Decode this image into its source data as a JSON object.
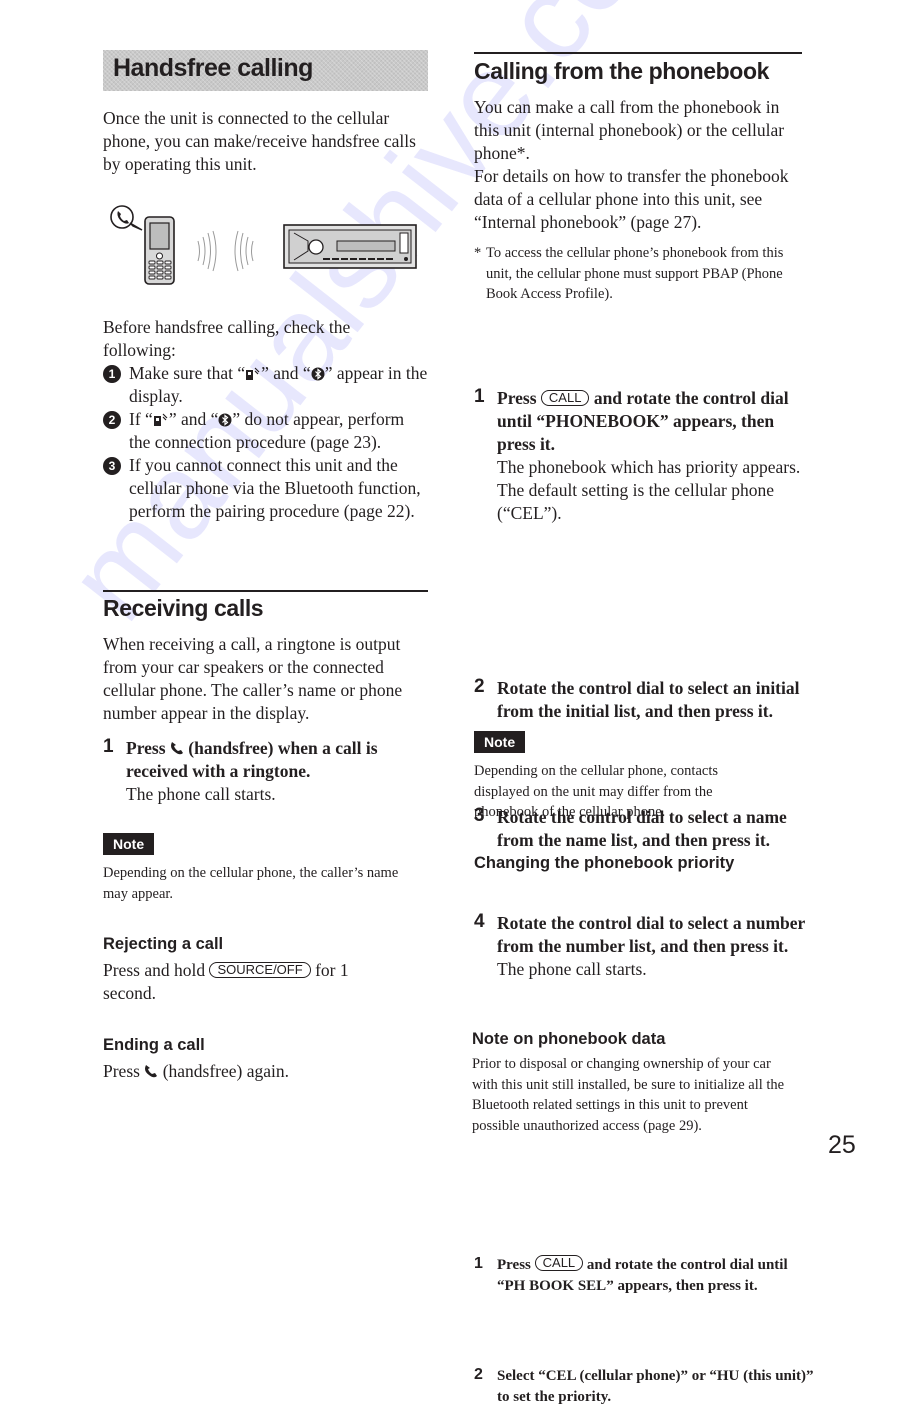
{
  "page_number": "25",
  "watermark": "manualshive.com",
  "left": {
    "title": "Handsfree calling",
    "intro": "Once the unit is connected to the cellular phone, you can make/receive handsfree calls by operating this unit.",
    "illustration": {
      "phone_icon": "mobile-phone-icon",
      "waves_icon": "signal-waves-icon",
      "unit_icon": "car-stereo-icon"
    },
    "checklist_intro": "Before handsfree calling, check the following:",
    "checklist": [
      {
        "num": "1",
        "parts": [
          "Make sure that “",
          "” and “",
          "” appear in the display."
        ]
      },
      {
        "num": "2",
        "parts": [
          "If “",
          "” and “",
          "” do not appear, perform the connection procedure (page 23)."
        ]
      },
      {
        "num": "3",
        "text": "If you cannot connect this unit and the cellular phone via the Bluetooth function, perform the pairing procedure (page 22)."
      }
    ],
    "receiving": {
      "heading": "Receiving calls",
      "body": "When receiving a call, a ringtone is output from your car speakers or the connected cellular phone. The caller’s name or phone number appear in the display.",
      "step": {
        "num": "1",
        "bold_pre": "Press",
        "bold_post": "(handsfree) when a call is received with a ringtone.",
        "result": "The phone call starts."
      },
      "note_label": "Note",
      "note_text": "Depending on the cellular phone, the caller’s name may appear."
    },
    "rejecting": {
      "heading": "Rejecting a call",
      "pre": "Press and hold",
      "key": "SOURCE/OFF",
      "post": "for 1 second."
    },
    "ending": {
      "heading": "Ending a call",
      "pre": "Press",
      "post": "(handsfree) again."
    }
  },
  "right": {
    "heading": "Calling from the phonebook",
    "intro1": "You can make a call from the phonebook in this unit (internal phonebook) or the cellular phone*.",
    "intro2": "For details on how to transfer the phonebook data of a cellular phone into this unit, see “Internal phonebook” (page 27).",
    "footnote": "To access the cellular phone’s phonebook from this unit, the cellular phone must support PBAP (Phone Book Access Profile).",
    "footnote_mark": "*",
    "steps": [
      {
        "num": "1",
        "pre": "Press",
        "key": "CALL",
        "post": "and rotate the control dial until “PHONEBOOK” appears, then press it.",
        "result": "The phonebook which has priority appears. The default setting is the cellular phone (“CEL”)."
      },
      {
        "num": "2",
        "text": "Rotate the control dial to select an initial from the initial list, and then press it."
      },
      {
        "num": "3",
        "text": "Rotate the control dial to select a name from the name list, and then press it."
      },
      {
        "num": "4",
        "text": "Rotate the control dial to select a number from the number list, and then press it.",
        "result": "The phone call starts."
      }
    ],
    "note_label": "Note",
    "note_text": "Depending on the cellular phone, contacts displayed on the unit may differ from the phonebook of the cellular phone.",
    "priority": {
      "heading": "Changing the phonebook priority",
      "steps": [
        {
          "num": "1",
          "pre": "Press",
          "key": "CALL",
          "post": "and rotate the control dial until “PH BOOK SEL” appears, then press it."
        },
        {
          "num": "2",
          "text": "Select “CEL (cellular phone)” or “HU (this unit)” to set the priority."
        }
      ]
    },
    "phonebook_data": {
      "heading": "Note on phonebook data",
      "text": "Prior to disposal or changing ownership of your car with this unit still installed, be sure to initialize all the Bluetooth related settings in this unit to prevent possible unauthorized access (page 29)."
    }
  }
}
